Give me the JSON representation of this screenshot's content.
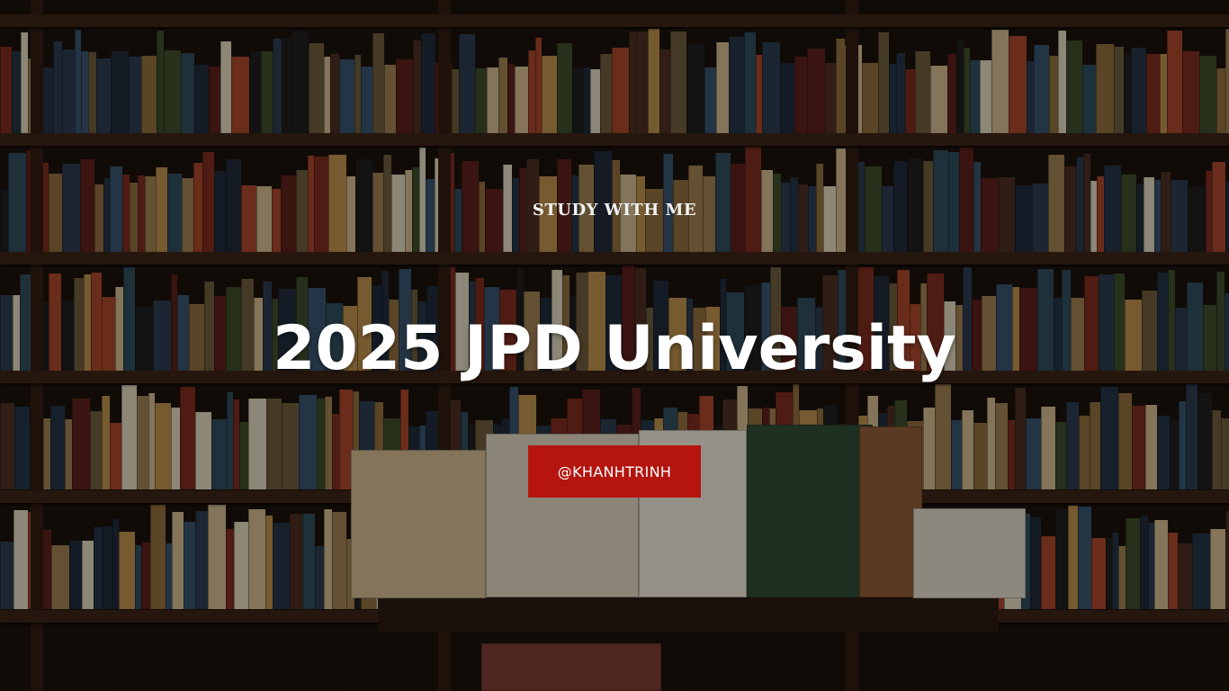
{
  "eyebrow": "STUDY WITH ME",
  "title": "2025 JPD University",
  "handle": "@KHANHTRINH",
  "colors": {
    "wood": "#3b2416",
    "handle_bg": "#b5150e",
    "text": "#ffffff"
  },
  "background": "bookshelves-photo"
}
